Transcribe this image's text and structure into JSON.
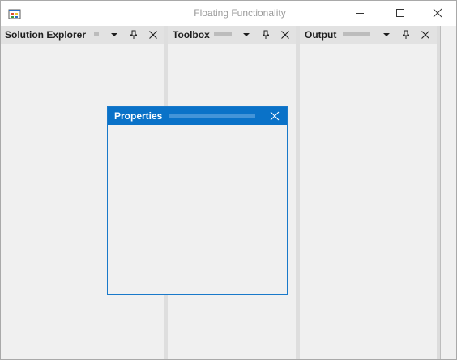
{
  "window": {
    "title": "Floating Functionality",
    "icon": "app-window-icon",
    "controls": [
      "minimize-icon",
      "maximize-icon",
      "close-icon"
    ]
  },
  "panels": [
    {
      "title": "Solution Explorer",
      "buttons": [
        "dropdown-arrow-icon",
        "pin-icon",
        "close-icon"
      ]
    },
    {
      "title": "Toolbox",
      "buttons": [
        "dropdown-arrow-icon",
        "pin-icon",
        "close-icon"
      ]
    },
    {
      "title": "Output",
      "buttons": [
        "dropdown-arrow-icon",
        "pin-icon",
        "close-icon"
      ]
    }
  ],
  "floating_panel": {
    "title": "Properties",
    "buttons": [
      "close-icon"
    ]
  },
  "colors": {
    "accent": "#0a72c8",
    "panel_header": "#e2e2e2",
    "background": "#f0f0f0",
    "title_text": "#9a9a9a"
  }
}
